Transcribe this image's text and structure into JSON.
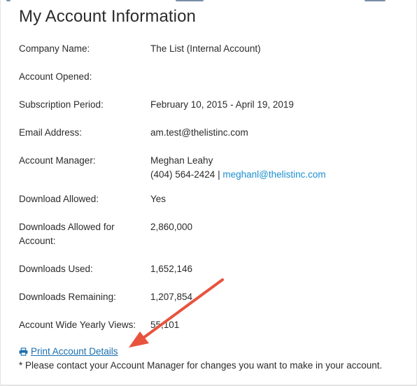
{
  "title": "My Account Information",
  "rows": [
    {
      "label": "Company Name:",
      "value": "The List (Internal Account)"
    },
    {
      "label": "Account Opened:",
      "value": ""
    },
    {
      "label": "Subscription Period:",
      "value": "February 10, 2015 - April 19, 2019"
    },
    {
      "label": "Email Address:",
      "value": "am.test@thelistinc.com"
    },
    {
      "label": "Account Manager:",
      "value": "Meghan Leahy",
      "phone": "(404) 564-2424",
      "separator": " | ",
      "email": "meghanl@thelistinc.com"
    },
    {
      "label": "Download Allowed:",
      "value": "Yes"
    },
    {
      "label": "Downloads Allowed for Account:",
      "value": "2,860,000"
    },
    {
      "label": "Downloads Used:",
      "value": "1,652,146"
    },
    {
      "label": "Downloads Remaining:",
      "value": "1,207,854"
    },
    {
      "label": "Account Wide Yearly Views:",
      "value": "55,101"
    }
  ],
  "print_link": {
    "label": "Print Account Details",
    "icon": "print-icon"
  },
  "note": "* Please contact your Account Manager for changes you want to make in your account.",
  "colors": {
    "link": "#1a8fd0",
    "arrow": "#e8533d",
    "text": "#2b2b2b"
  }
}
